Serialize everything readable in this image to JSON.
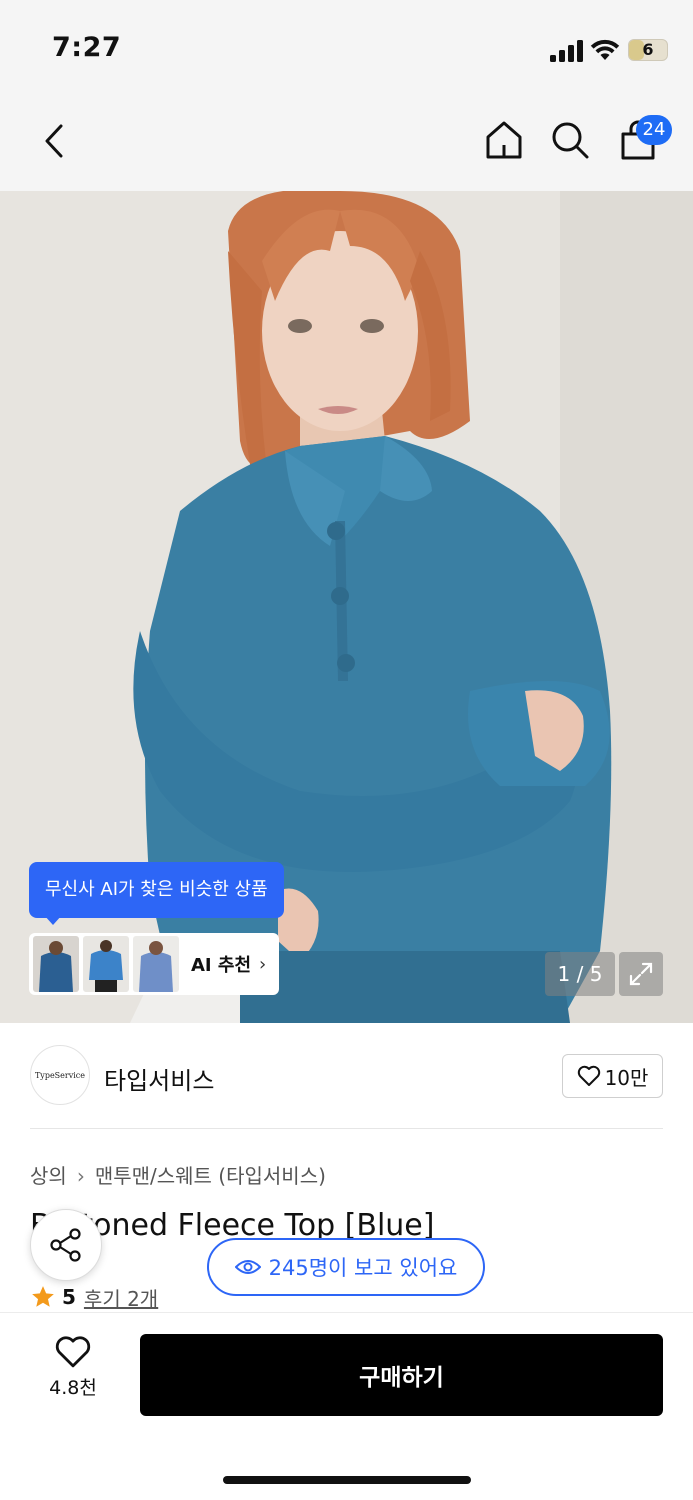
{
  "status_bar": {
    "time": "7:27",
    "battery_level": "6"
  },
  "header": {
    "back_icon": "chevron-left-icon",
    "home_icon": "home-icon",
    "search_icon": "search-icon",
    "cart_icon": "shopping-bag-icon",
    "cart_count": "24"
  },
  "hero": {
    "ai_tooltip": "무신사 AI가 찾은 비슷한 상품",
    "ai_recommend_label": "AI 추천",
    "image_counter": "1 / 5",
    "expand_icon": "expand-icon"
  },
  "brand": {
    "logo_text": "TypeService",
    "name": "타입서비스",
    "like_count": "10만"
  },
  "breadcrumb": [
    "상의",
    "맨투맨/스웨트 (타입서비스)"
  ],
  "product": {
    "title": "Buttoned Fleece Top [Blue]",
    "rating": "5",
    "review_link": "후기 2개",
    "viewers": "245명이 보고 있어요"
  },
  "bottom_bar": {
    "like_count": "4.8천",
    "buy_label": "구매하기"
  },
  "colors": {
    "accent_blue": "#2d66f6",
    "buy_button": "#000000",
    "star": "#f39a1c",
    "sweater": "#3a7fa3"
  }
}
